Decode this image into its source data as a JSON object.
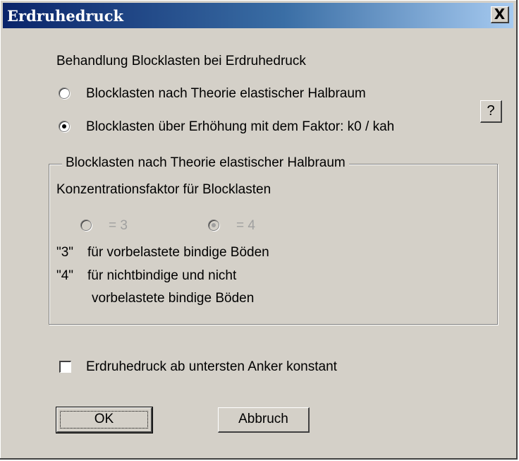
{
  "window": {
    "title": "Erdruhedruck",
    "close_label": "X"
  },
  "intro_label": "Behandlung Blocklasten bei Erdruhedruck",
  "mode": {
    "option_halbraum": "Blocklasten nach Theorie elastischer Halbraum",
    "option_faktor": "Blocklasten über Erhöhung mit dem Faktor: k0 / kah",
    "selected": "option_faktor"
  },
  "help_label": "?",
  "group": {
    "legend": "Blocklasten nach Theorie elastischer Halbraum",
    "subtitle": "Konzentrationsfaktor für Blocklasten",
    "option_3": "= 3",
    "option_4": "= 4",
    "selected": "option_4",
    "enabled": false,
    "note1_key": "\"3\"",
    "note1_text": "für vorbelastete bindige Böden",
    "note2_key": "\"4\"",
    "note2_text": "für nichtbindige und nicht",
    "note2_text_cont": "vorbelastete bindige Böden"
  },
  "constant_checkbox": {
    "label": "Erdruhedruck ab untersten Anker konstant",
    "checked": false
  },
  "buttons": {
    "ok": "OK",
    "cancel": "Abbruch"
  }
}
